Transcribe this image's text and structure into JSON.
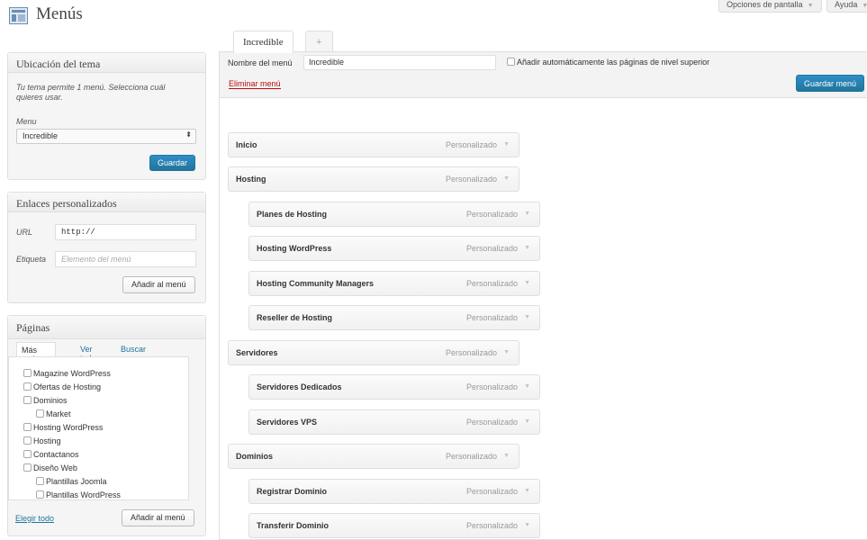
{
  "header": {
    "title": "Menús",
    "screen_options": "Opciones de pantalla",
    "help": "Ayuda"
  },
  "theme_locations": {
    "title": "Ubicación del tema",
    "description": "Tu tema permite 1 menú. Selecciona cuál quieres usar.",
    "menu_label": "Menu",
    "selected_menu": "Incredible",
    "save_button": "Guardar"
  },
  "custom_links": {
    "title": "Enlaces personalizados",
    "url_label": "URL",
    "url_value": "http://",
    "label_label": "Etiqueta",
    "label_placeholder": "Elemento del menú",
    "add_button": "Añadir al menú"
  },
  "pages": {
    "title": "Páginas",
    "tabs": [
      "Más reciente",
      "Ver todo",
      "Buscar"
    ],
    "items": [
      {
        "label": "Magazine WordPress",
        "depth": 0
      },
      {
        "label": "Ofertas de Hosting",
        "depth": 0
      },
      {
        "label": "Dominios",
        "depth": 0
      },
      {
        "label": "Market",
        "depth": 1
      },
      {
        "label": "Hosting WordPress",
        "depth": 0
      },
      {
        "label": "Hosting",
        "depth": 0
      },
      {
        "label": "Contactanos",
        "depth": 0
      },
      {
        "label": "Diseño Web",
        "depth": 0
      },
      {
        "label": "Plantillas Joomla",
        "depth": 1
      },
      {
        "label": "Plantillas WordPress",
        "depth": 1
      }
    ],
    "select_all": "Elegir todo",
    "add_button": "Añadir al menú"
  },
  "menu_tabs": {
    "active": "Incredible",
    "add": "+"
  },
  "menu_editor": {
    "name_label": "Nombre del menú",
    "name_value": "Incredible",
    "auto_add_label": "Añadir automáticamente las páginas de nivel superior",
    "delete_link": "Eliminar menú",
    "save_button": "Guardar menú"
  },
  "menu_items": [
    {
      "title": "Inicio",
      "type": "Personalizado",
      "depth": 0
    },
    {
      "title": "Hosting",
      "type": "Personalizado",
      "depth": 0
    },
    {
      "title": "Planes de Hosting",
      "type": "Personalizado",
      "depth": 1
    },
    {
      "title": "Hosting WordPress",
      "type": "Personalizado",
      "depth": 1
    },
    {
      "title": "Hosting Community Managers",
      "type": "Personalizado",
      "depth": 1
    },
    {
      "title": "Reseller de Hosting",
      "type": "Personalizado",
      "depth": 1
    },
    {
      "title": "Servidores",
      "type": "Personalizado",
      "depth": 0
    },
    {
      "title": "Servidores Dedicados",
      "type": "Personalizado",
      "depth": 1
    },
    {
      "title": "Servidores VPS",
      "type": "Personalizado",
      "depth": 1
    },
    {
      "title": "Dominios",
      "type": "Personalizado",
      "depth": 0
    },
    {
      "title": "Registrar Dominio",
      "type": "Personalizado",
      "depth": 1
    },
    {
      "title": "Transferir Dominio",
      "type": "Personalizado",
      "depth": 1
    }
  ],
  "colors": {
    "primary_button": "#21759b",
    "delete_link": "#bc0b0b",
    "link": "#21759b"
  }
}
